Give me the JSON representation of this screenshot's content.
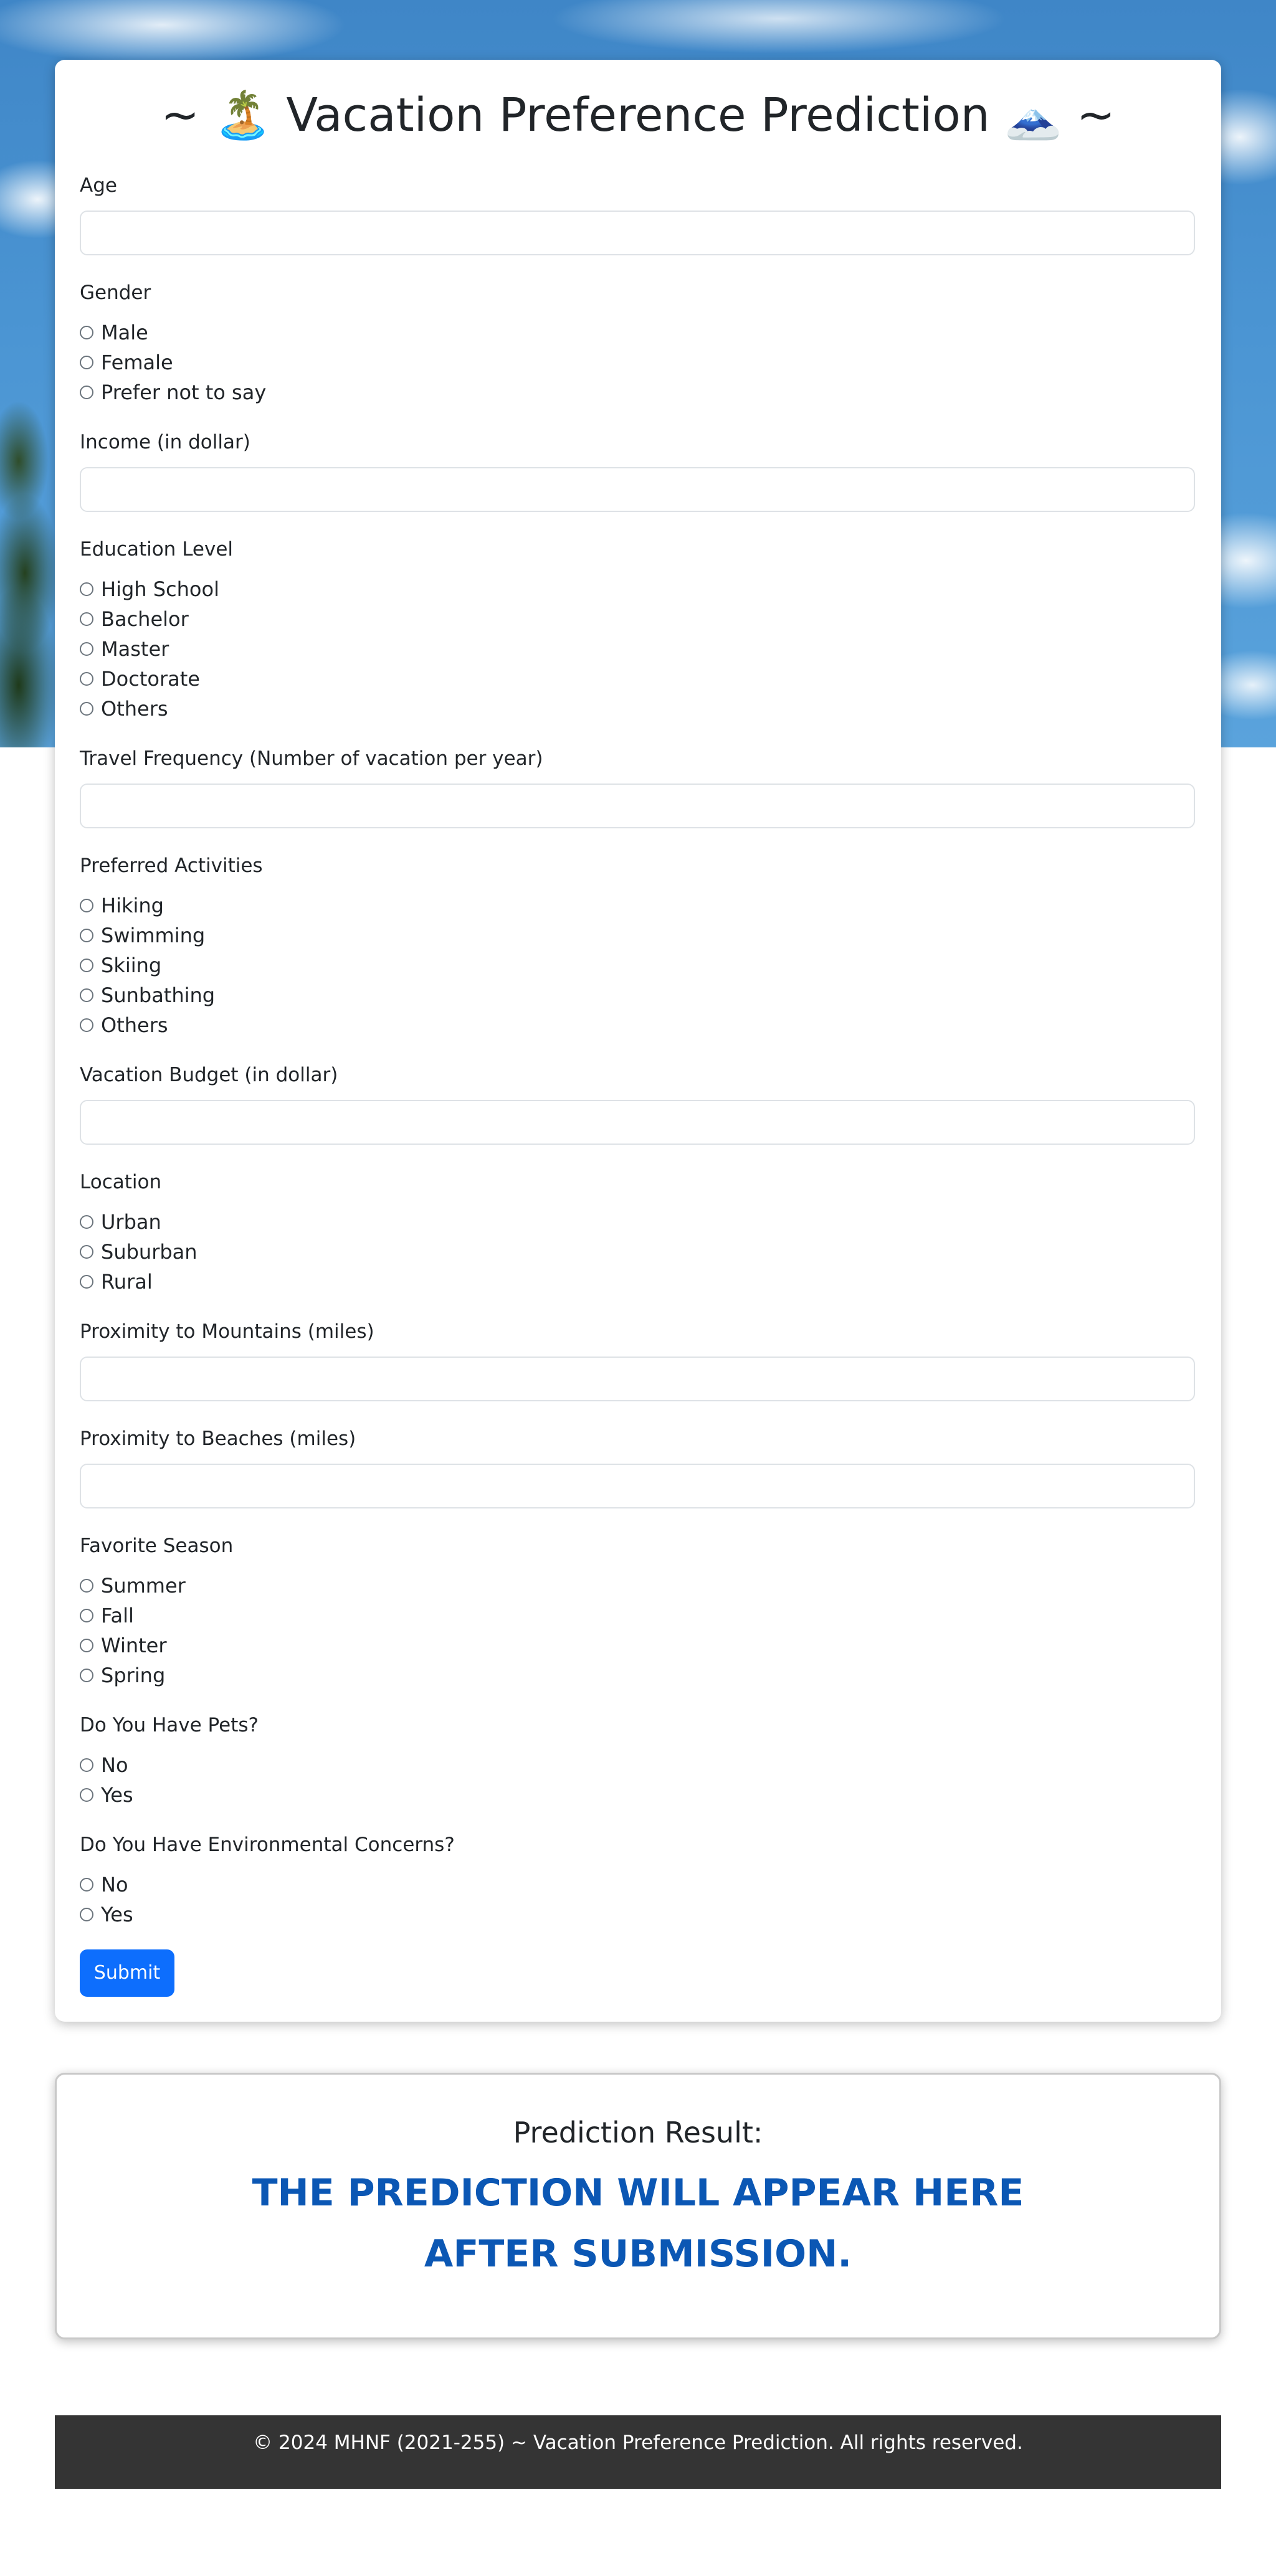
{
  "header": {
    "title": "~ 🏝️ Vacation Preference Prediction 🗻 ~"
  },
  "form": {
    "age_label": "Age",
    "gender_label": "Gender",
    "gender_options": [
      "Male",
      "Female",
      "Prefer not to say"
    ],
    "income_label": "Income (in dollar)",
    "education_label": "Education Level",
    "education_options": [
      "High School",
      "Bachelor",
      "Master",
      "Doctorate",
      "Others"
    ],
    "travel_frequency_label": "Travel Frequency (Number of vacation per year)",
    "activities_label": "Preferred Activities",
    "activities_options": [
      "Hiking",
      "Swimming",
      "Skiing",
      "Sunbathing",
      "Others"
    ],
    "budget_label": "Vacation Budget (in dollar)",
    "location_label": "Location",
    "location_options": [
      "Urban",
      "Suburban",
      "Rural"
    ],
    "mountains_label": "Proximity to Mountains (miles)",
    "beaches_label": "Proximity to Beaches (miles)",
    "season_label": "Favorite Season",
    "season_options": [
      "Summer",
      "Fall",
      "Winter",
      "Spring"
    ],
    "pets_label": "Do You Have Pets?",
    "pets_options": [
      "No",
      "Yes"
    ],
    "environment_label": "Do You Have Environmental Concerns?",
    "environment_options": [
      "No",
      "Yes"
    ],
    "submit_label": "Submit"
  },
  "result": {
    "heading": "Prediction Result:",
    "text": "THE PREDICTION WILL APPEAR HERE AFTER SUBMISSION."
  },
  "footer": {
    "text": "© 2024 MHNF (2021-255) ~ Vacation Preference Prediction. All rights reserved."
  },
  "colors": {
    "accent": "#0d6efd",
    "result_text": "#0b57b4",
    "footer_bg": "#343434"
  }
}
